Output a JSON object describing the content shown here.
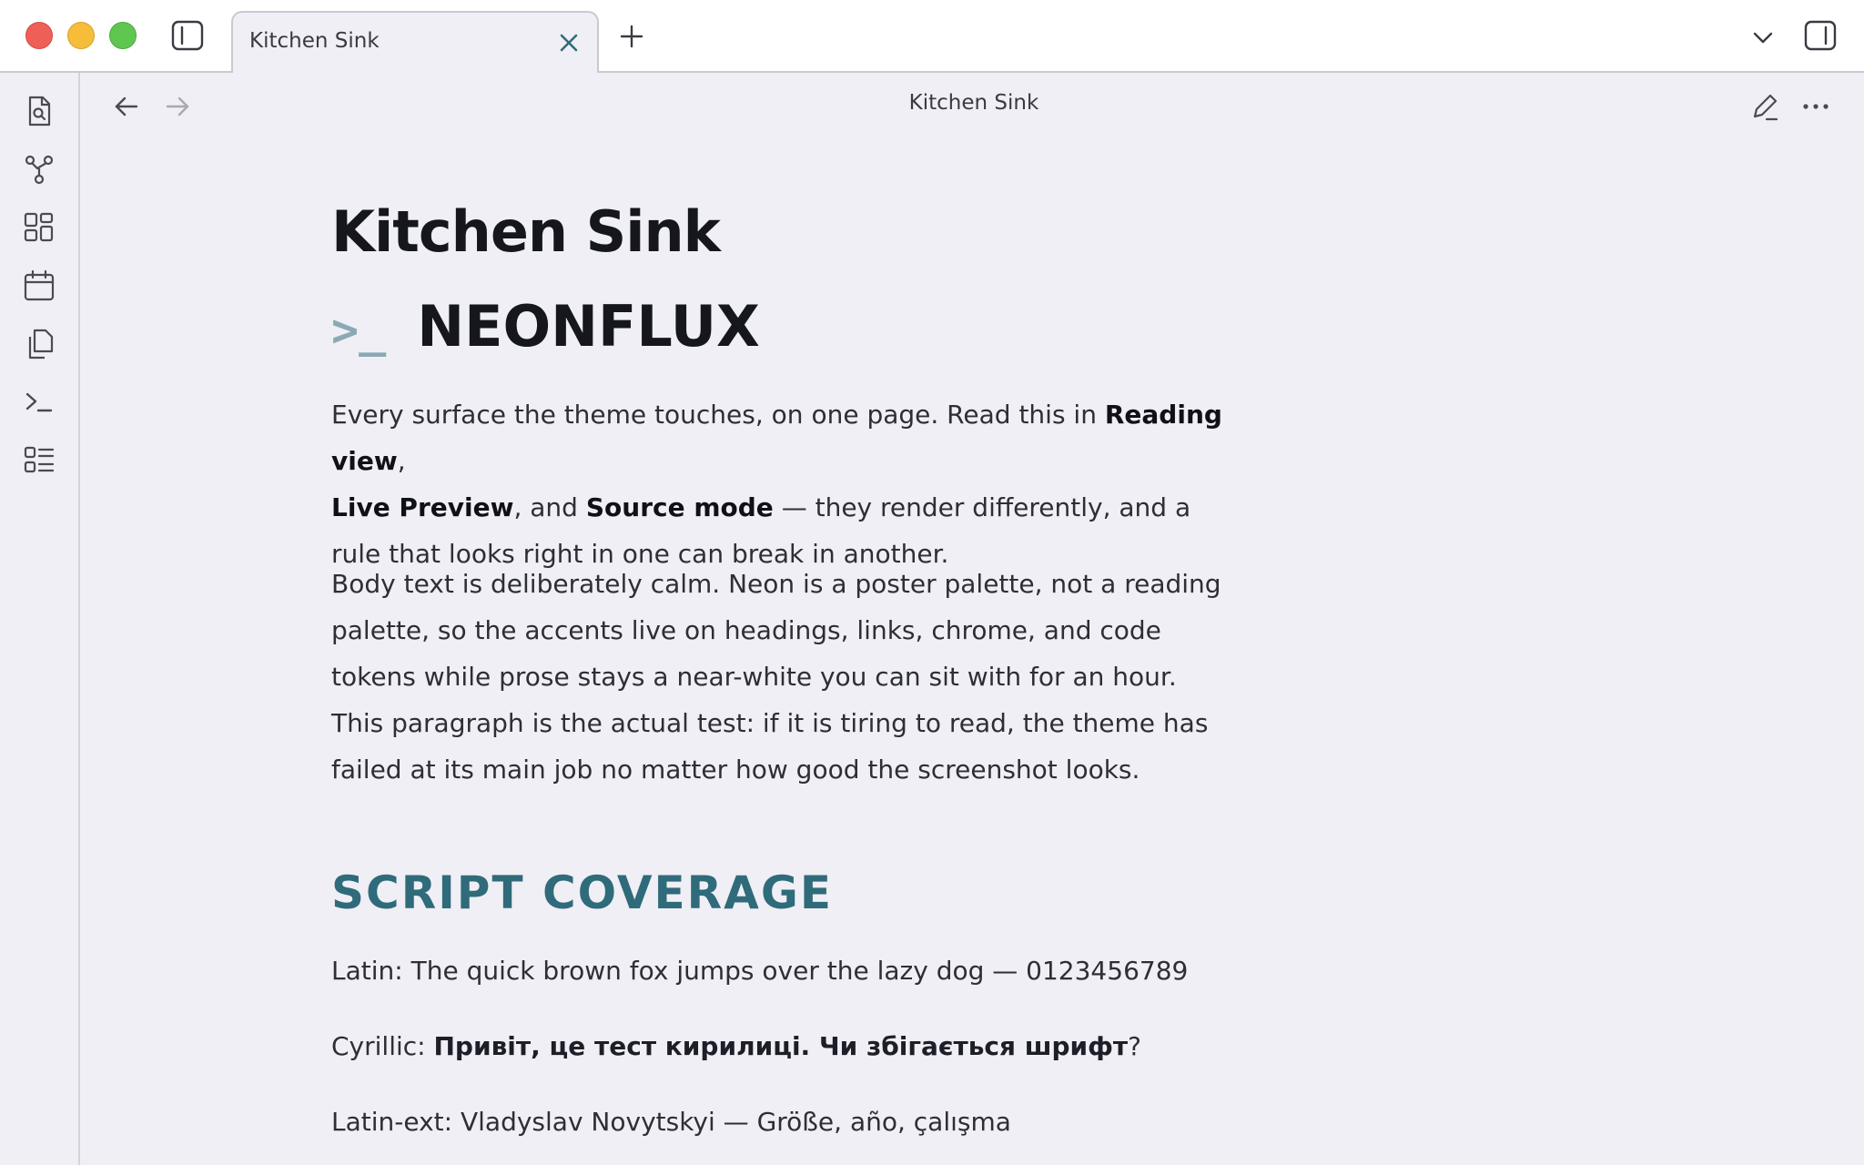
{
  "tab": {
    "title": "Kitchen Sink"
  },
  "view": {
    "title": "Kitchen Sink"
  },
  "doc": {
    "h1": "Kitchen Sink",
    "brand_prompt": ">_",
    "brand_name": "NEONFLUX",
    "p1": {
      "a": "Every surface the theme touches, on one page. Read this in ",
      "b1": "Reading view",
      "c": ", ",
      "b2": "Live Preview",
      "d": ", and ",
      "b3": "Source mode",
      "e": " — they render differently, and a rule that looks right in one can break in another."
    },
    "p2": "Body text is deliberately calm. Neon is a poster palette, not a reading palette, so the accents live on headings, links, chrome, and code tokens while prose stays a near-white you can sit with for an hour. This paragraph is the actual test: if it is tiring to read, the theme has failed at its main job no matter how good the screenshot looks.",
    "h2": "SCRIPT COVERAGE",
    "latin_label": "Latin: ",
    "latin_text": "The quick brown fox jumps over the lazy dog — 0123456789",
    "cyrillic_label": "Cyrillic: ",
    "cyrillic_text": "Привіт, це тест кирилиці. Чи збігається шрифт",
    "cyrillic_end": "?",
    "latinext_label": "Latin-ext: ",
    "latinext_text": "Vladyslav Novytskyi — Größe, año, çalışma"
  },
  "colors": {
    "accent_heading": "#2f6b7a",
    "prompt": "#8aa9b4",
    "background": "#efeff5"
  },
  "icons": {
    "ribbon": [
      "search-file-icon",
      "graph-icon",
      "layout-grid-icon",
      "calendar-icon",
      "copy-icon",
      "terminal-icon",
      "list-icon"
    ]
  }
}
